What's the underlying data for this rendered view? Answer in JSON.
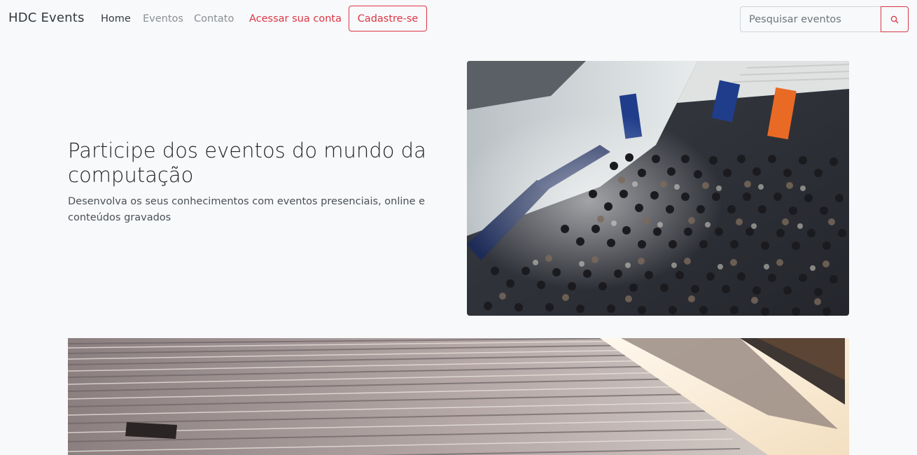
{
  "navbar": {
    "brand": "HDC Events",
    "links": {
      "home": "Home",
      "eventos": "Eventos",
      "contato": "Contato",
      "login": "Acessar sua conta"
    },
    "signup_label": "Cadastre-se",
    "search": {
      "placeholder": "Pesquisar eventos",
      "icon": "search-icon"
    }
  },
  "hero": {
    "title": "Participe dos eventos do mundo da computação",
    "subtitle": "Desenvolva os seus conhecimentos com eventos presenciais, online e conteúdos gravados"
  },
  "colors": {
    "accent": "#dc3545",
    "background": "#f8f9fa",
    "text": "#212529",
    "muted": "#8a8f94"
  }
}
